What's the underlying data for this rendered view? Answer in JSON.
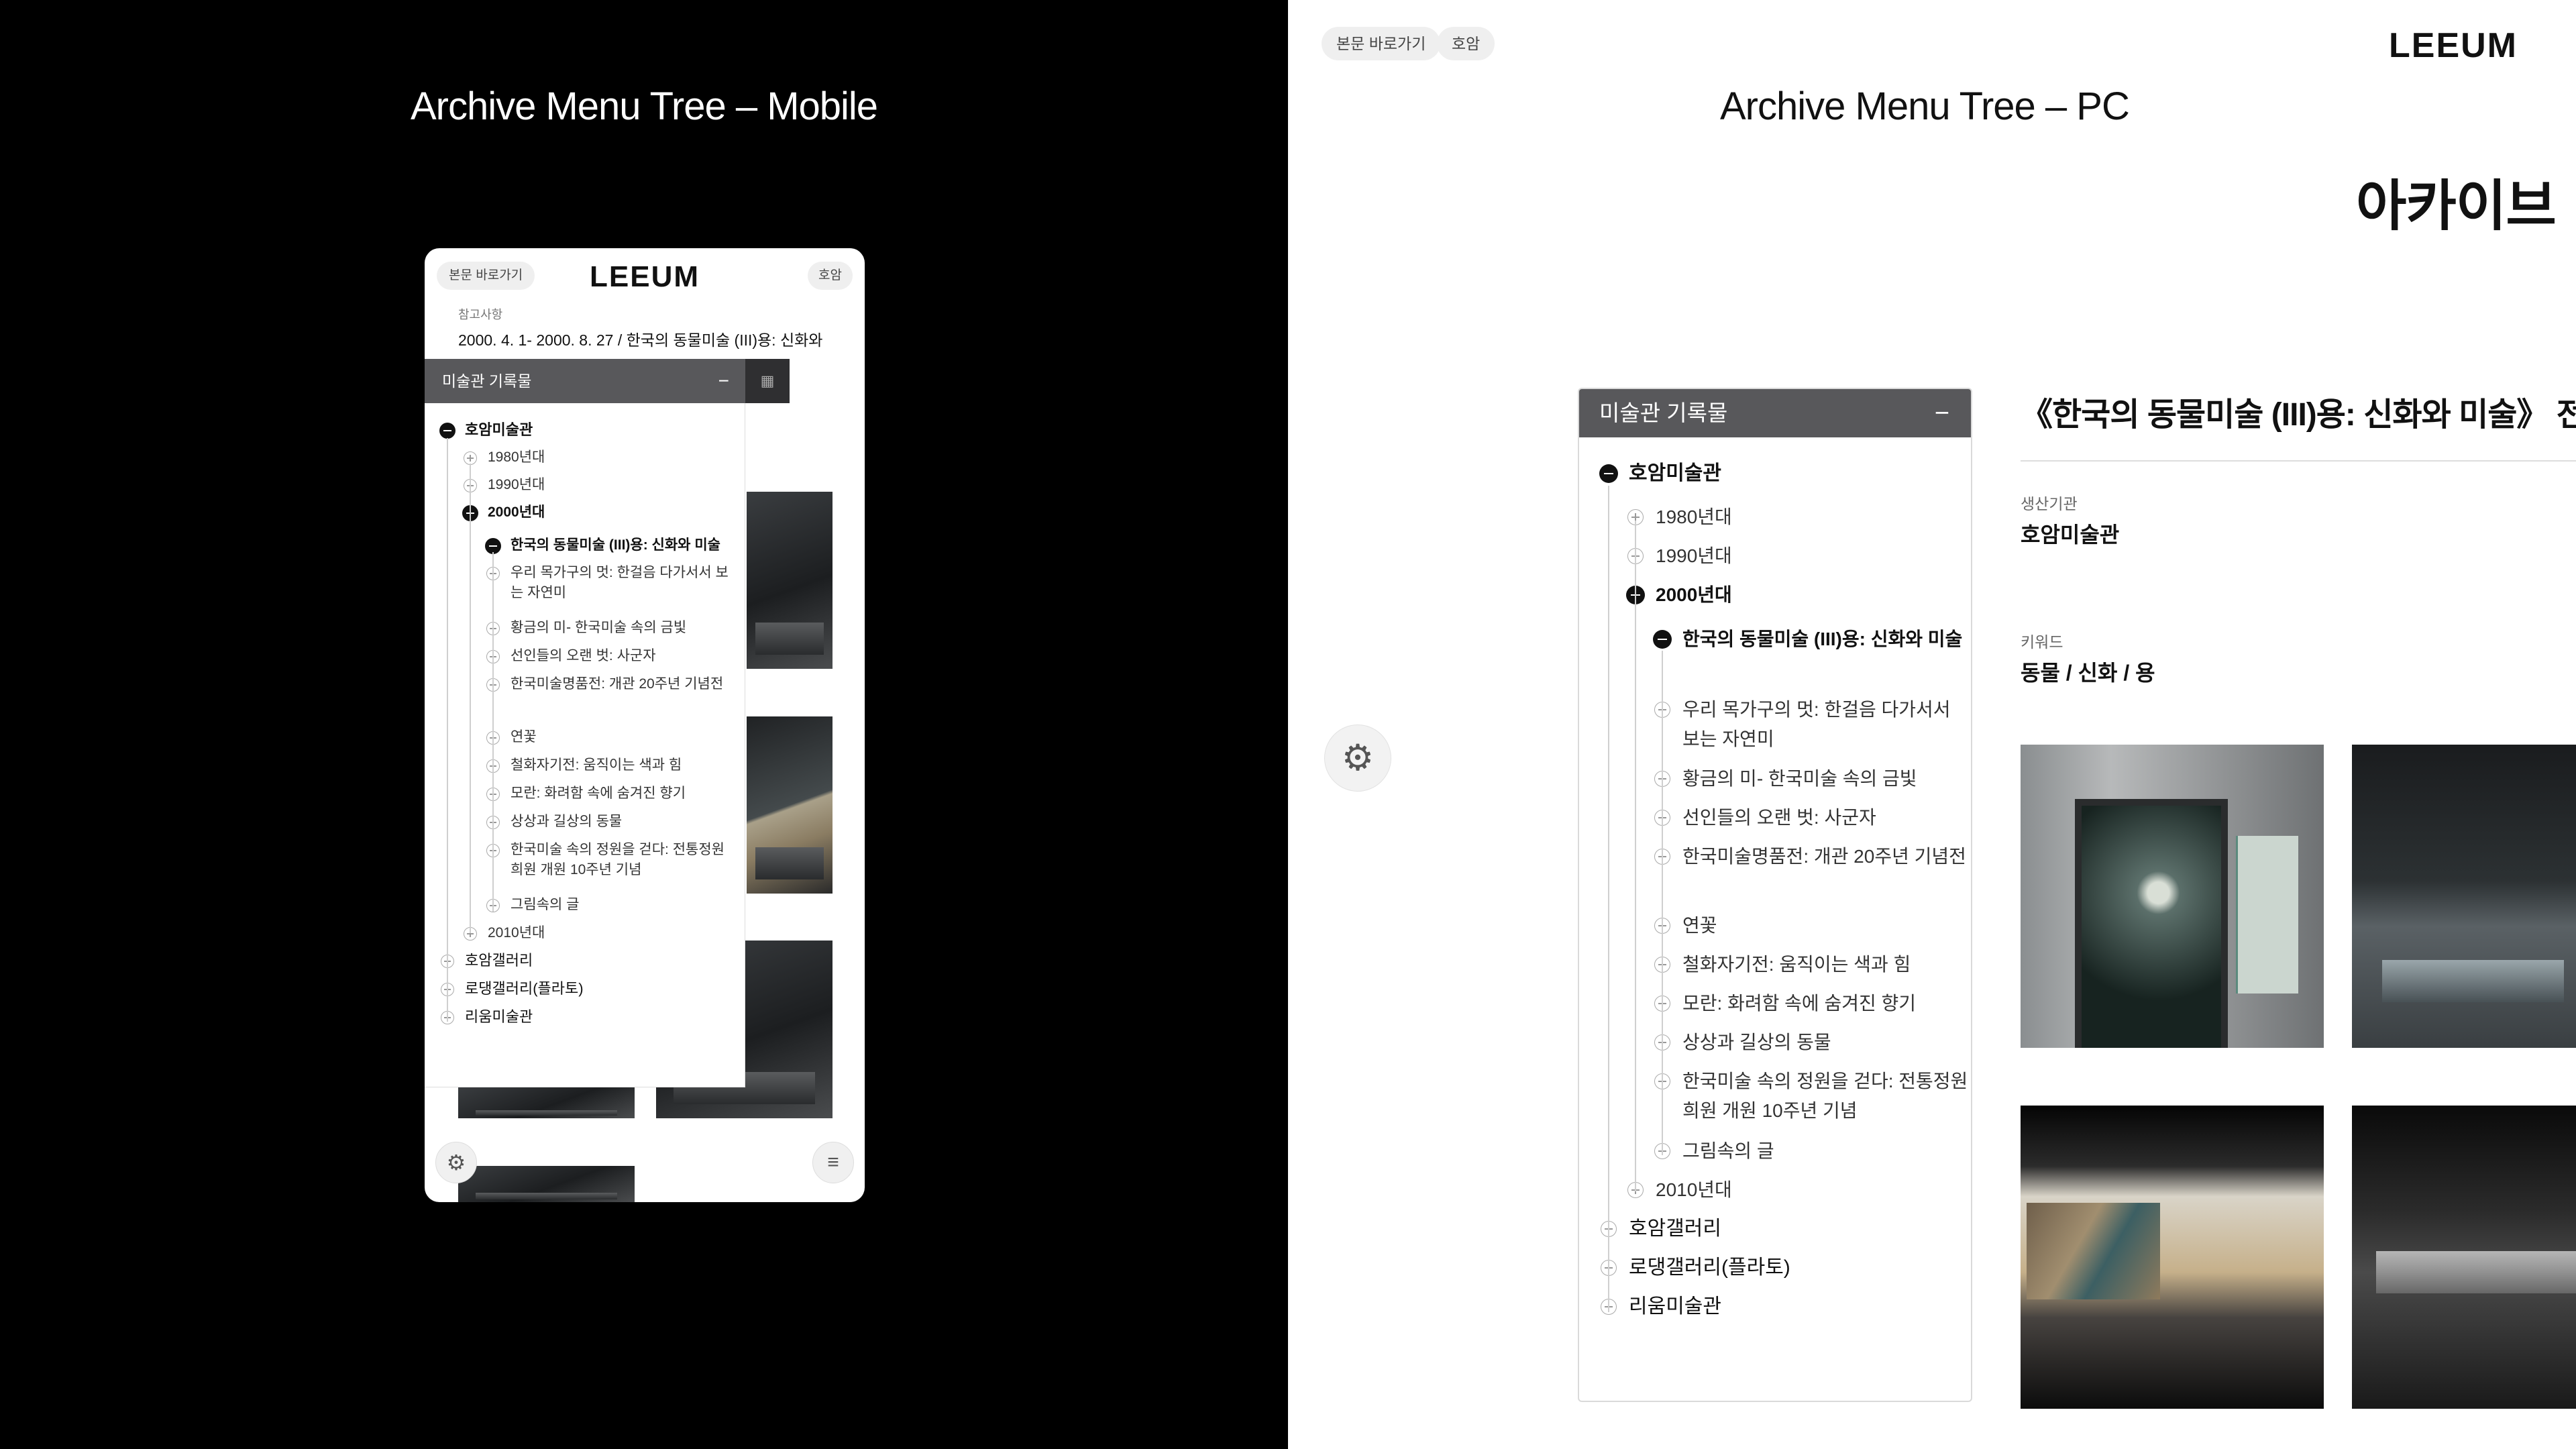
{
  "mobile_section": {
    "title": "Archive Menu Tree – Mobile",
    "skip_link": "본문 바로가기",
    "lang_toggle": "호암",
    "logo": "LEEUM",
    "caption_label": "참고사항",
    "caption_text": "2000. 4. 1- 2000. 8. 27 / 한국의 동물미술 (III)용: 신화와",
    "panel_title": "미술관 기록물",
    "panel_side_icon": "qr-icon",
    "settings_icon": "settings-icon",
    "menu_icon": "hamburger-menu-icon"
  },
  "pc_section": {
    "title": "Archive Menu Tree – PC",
    "skip_link": "본문 바로가기",
    "lang_toggle": "호암",
    "logo": "LEEUM",
    "heading": "아카이브",
    "settings_icon": "settings-icon",
    "panel_title": "미술관 기록물",
    "detail_title": "《한국의 동물미술 (III)용: 신화와 미술》 전",
    "producer_label": "생산기관",
    "producer_value": "호암미술관",
    "keyword_label": "키워드",
    "keyword_value": "동물 / 신화 / 용"
  },
  "mobile_tree": [
    {
      "label": "호암미술관",
      "state": "open",
      "level": 0,
      "active": true
    },
    {
      "label": "1980년대",
      "state": "closed",
      "level": 1
    },
    {
      "label": "1990년대",
      "state": "closed",
      "level": 1
    },
    {
      "label": "2000년대",
      "state": "open",
      "level": 1,
      "active": true
    },
    {
      "label": "한국의 동물미술 (III)용: 신화와 미술",
      "state": "open",
      "level": 2,
      "active": true
    },
    {
      "label": "우리 목가구의 멋: 한걸음 다가서서 보는 자연미",
      "state": "closed",
      "level": 2
    },
    {
      "label": "황금의 미- 한국미술 속의 금빛",
      "state": "closed",
      "level": 2
    },
    {
      "label": "선인들의 오랜 벗: 사군자",
      "state": "closed",
      "level": 2
    },
    {
      "label": "한국미술명품전: 개관 20주년 기념전",
      "state": "closed",
      "level": 2
    },
    {
      "label": "연꽃",
      "state": "closed",
      "level": 2
    },
    {
      "label": "철화자기전: 움직이는 색과 힘",
      "state": "closed",
      "level": 2
    },
    {
      "label": "모란: 화려함 속에 숨겨진 향기",
      "state": "closed",
      "level": 2
    },
    {
      "label": "상상과 길상의 동물",
      "state": "closed",
      "level": 2
    },
    {
      "label": "한국미술 속의 정원을 걷다: 전통정원 희원 개원 10주년 기념",
      "state": "closed",
      "level": 2
    },
    {
      "label": "그림속의 글",
      "state": "closed",
      "level": 2
    },
    {
      "label": "2010년대",
      "state": "closed",
      "level": 1
    },
    {
      "label": "호암갤러리",
      "state": "closed",
      "level": 0
    },
    {
      "label": "로댕갤러리(플라토)",
      "state": "closed",
      "level": 0
    },
    {
      "label": "리움미술관",
      "state": "closed",
      "level": 0
    }
  ],
  "pc_tree": [
    {
      "label": "호암미술관",
      "state": "open",
      "level": 0,
      "active": true
    },
    {
      "label": "1980년대",
      "state": "closed",
      "level": 1
    },
    {
      "label": "1990년대",
      "state": "closed",
      "level": 1
    },
    {
      "label": "2000년대",
      "state": "open",
      "level": 1,
      "active": true
    },
    {
      "label": "한국의 동물미술 (III)용: 신화와 미술",
      "state": "open",
      "level": 2,
      "active": true
    },
    {
      "label": "우리 목가구의 멋: 한걸음 다가서서 보는 자연미",
      "state": "closed",
      "level": 2
    },
    {
      "label": "황금의 미- 한국미술 속의 금빛",
      "state": "closed",
      "level": 2
    },
    {
      "label": "선인들의 오랜 벗: 사군자",
      "state": "closed",
      "level": 2
    },
    {
      "label": "한국미술명품전: 개관 20주년 기념전",
      "state": "closed",
      "level": 2
    },
    {
      "label": "연꽃",
      "state": "closed",
      "level": 2
    },
    {
      "label": "철화자기전: 움직이는 색과 힘",
      "state": "closed",
      "level": 2
    },
    {
      "label": "모란: 화려함 속에 숨겨진 향기",
      "state": "closed",
      "level": 2
    },
    {
      "label": "상상과 길상의 동물",
      "state": "closed",
      "level": 2
    },
    {
      "label": "한국미술 속의 정원을 걷다: 전통정원 희원 개원 10주년 기념",
      "state": "closed",
      "level": 2
    },
    {
      "label": "그림속의 글",
      "state": "closed",
      "level": 2
    },
    {
      "label": "2010년대",
      "state": "closed",
      "level": 1
    },
    {
      "label": "호암갤러리",
      "state": "closed",
      "level": 0
    },
    {
      "label": "로댕갤러리(플라토)",
      "state": "closed",
      "level": 0
    },
    {
      "label": "리움미술관",
      "state": "closed",
      "level": 0
    }
  ],
  "colors": {
    "left_background": "#000000",
    "right_background": "#ffffff",
    "panel_header": "#58585b",
    "text": "#111111"
  }
}
